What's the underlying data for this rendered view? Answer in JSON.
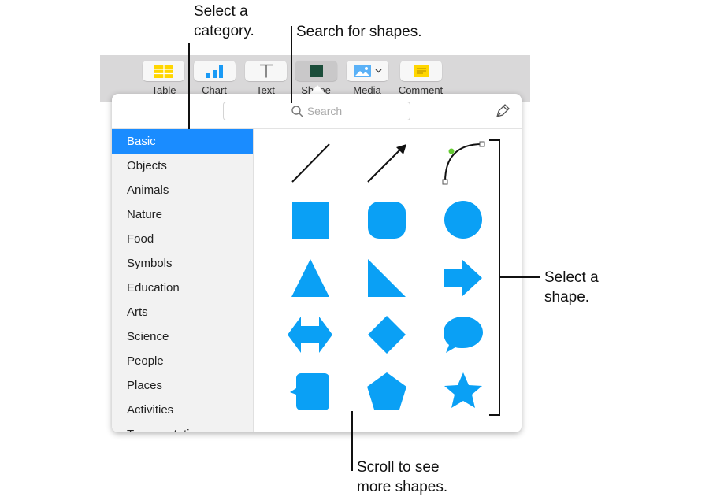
{
  "callouts": {
    "category": "Select a\ncategory.",
    "search": "Search for shapes.",
    "shape": "Select a\nshape.",
    "scroll": "Scroll to see\nmore shapes."
  },
  "toolbar": {
    "buttons": [
      {
        "label": "Table",
        "icon": "table-icon"
      },
      {
        "label": "Chart",
        "icon": "chart-icon"
      },
      {
        "label": "Text",
        "icon": "text-icon"
      },
      {
        "label": "Shape",
        "icon": "shape-icon"
      },
      {
        "label": "Media",
        "icon": "media-icon"
      },
      {
        "label": "Comment",
        "icon": "comment-icon"
      }
    ]
  },
  "popover": {
    "search_placeholder": "Search",
    "categories": [
      "Basic",
      "Objects",
      "Animals",
      "Nature",
      "Food",
      "Symbols",
      "Education",
      "Arts",
      "Science",
      "People",
      "Places",
      "Activities",
      "Transportation"
    ],
    "selected_category": "Basic",
    "shapes": [
      "line",
      "arrow-line",
      "curve",
      "square",
      "rounded-square",
      "circle",
      "triangle",
      "right-triangle",
      "arrow",
      "double-arrow",
      "diamond",
      "speech-bubble",
      "callout-square",
      "pentagon",
      "star"
    ]
  },
  "colors": {
    "accent": "#1a8cff",
    "shape": "#0aa0f5"
  }
}
